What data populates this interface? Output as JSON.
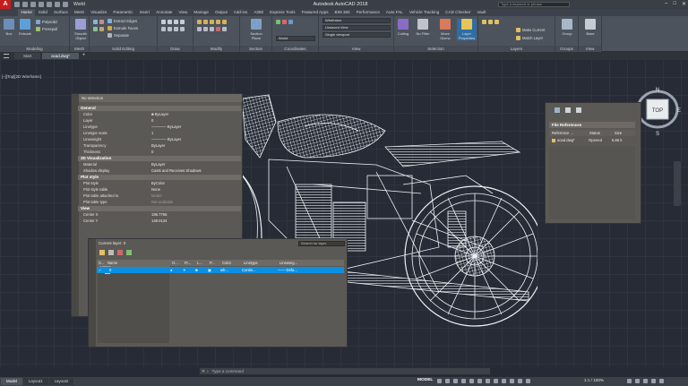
{
  "titlebar": {
    "logo": "A",
    "doc_tab_name": "World",
    "window_title": "Autodesk AutoCAD 2018",
    "search_placeholder": "Type a keyword or phrase",
    "min": "–",
    "max": "□",
    "close": "✕"
  },
  "ribbon_tabs": [
    "Home",
    "Solid",
    "Surface",
    "Mesh",
    "Visualize",
    "Parametric",
    "Insert",
    "Annotate",
    "View",
    "Manage",
    "Output",
    "Add-ins",
    "A360",
    "Express Tools",
    "Featured Apps",
    "BIM 360",
    "Performance",
    "Auto FAL",
    "Vehicle Tracking",
    "CAD Checker",
    "Vault"
  ],
  "ribbon_active_tab": "Home",
  "ribbon": {
    "panels": {
      "modeling": "Modeling",
      "mesh": "Mesh",
      "solid_editing": "Solid Editing",
      "draw": "Draw",
      "modify": "Modify",
      "section": "Section",
      "coordinates": "Coordinates",
      "view": "View",
      "selection": "Selection",
      "layers": "Layers",
      "groups": "Groups",
      "view2": "View"
    },
    "tools": {
      "box": "Box",
      "extrude": "Extrude",
      "polysolid": "Polysolid",
      "presspull": "Presspull",
      "smooth_object": "Smooth Object",
      "extract_edges": "Extract Edges",
      "extrude_faces": "Extrude Faces",
      "separate": "Separate",
      "section_plane": "Section Plane",
      "world": "World",
      "wireframe": "Wireframe",
      "unsaved_view": "Unsaved View",
      "single_viewport": "Single viewport",
      "culling": "Culling",
      "no_filter": "No Filter",
      "move_gizmo": "Move Gizmo",
      "layer_properties": "Layer Properties",
      "make_current": "Make Current",
      "match_layer": "Match Layer",
      "group": "Group",
      "base": "Base"
    }
  },
  "file_tabs": [
    "Start",
    "acad.dwg*"
  ],
  "file_tab_active": "acad.dwg*",
  "viewport_label": "[–][Top][2D Wireframe]",
  "viewcube": {
    "face": "TOP",
    "n": "N",
    "s": "S",
    "e": "E",
    "w": "W"
  },
  "properties": {
    "selection": "No selection",
    "sections": {
      "general": "General",
      "viz": "3D Visualization",
      "plot": "Plot style",
      "view": "View"
    },
    "general_rows": [
      {
        "k": "Color",
        "v": "■ ByLayer"
      },
      {
        "k": "Layer",
        "v": "0"
      },
      {
        "k": "Linetype",
        "v": "———— ByLayer"
      },
      {
        "k": "Linetype scale",
        "v": "1"
      },
      {
        "k": "Lineweight",
        "v": "———— ByLayer"
      },
      {
        "k": "Transparency",
        "v": "ByLayer"
      },
      {
        "k": "Thickness",
        "v": "0"
      }
    ],
    "viz_rows": [
      {
        "k": "Material",
        "v": "ByLayer"
      },
      {
        "k": "Shadow display",
        "v": "Casts and Receives Shadows"
      }
    ],
    "plot_rows": [
      {
        "k": "Plot style",
        "v": "ByColor"
      },
      {
        "k": "Plot style table",
        "v": "None"
      },
      {
        "k": "Plot table attached to",
        "v": "Model"
      },
      {
        "k": "Plot table type",
        "v": "Not available"
      }
    ],
    "view_rows": [
      {
        "k": "Center X",
        "v": "196.7756"
      },
      {
        "k": "Center Y",
        "v": "148.0134"
      }
    ]
  },
  "layer_manager": {
    "current_layer": "Current layer: 0",
    "search_placeholder": "Search for layer",
    "filters": "Filters",
    "columns": [
      "S...",
      "Name",
      "O...",
      "Fr...",
      "L...",
      "P...",
      "Color",
      "Linetype",
      "Lineweig..."
    ],
    "row": {
      "status": "✓",
      "name": "0",
      "color": "wh...",
      "linetype": "Contin...",
      "lineweight": "—— Defa..."
    }
  },
  "xref": {
    "title": "File References",
    "columns": [
      "Reference ...",
      "Status",
      "Size"
    ],
    "row": {
      "name": "acad.dwg*",
      "status": "Opened",
      "size": "5.65 k"
    }
  },
  "command_line": {
    "placeholder": "Type a command"
  },
  "status_bar": {
    "tabs": [
      "Model",
      "Layout1",
      "Layout2"
    ],
    "active_tab": "Model",
    "mode": "MODEL",
    "scale": "1:1 / 100%"
  },
  "colors": {
    "ribbon": "#4d535c",
    "canvas": "#262b35",
    "palette": "#5b5955",
    "selection": "#0d8fe0"
  }
}
